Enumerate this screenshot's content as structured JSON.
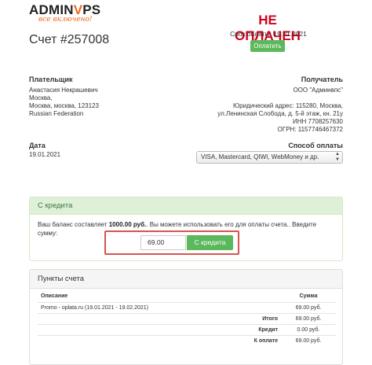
{
  "brand": {
    "name_a": "ADMIN",
    "name_v": "V",
    "name_b": "PS",
    "tagline": "все включено!"
  },
  "invoice": {
    "title": "Счет #257008"
  },
  "status": {
    "text": "НЕ ОПЛАЧЕН",
    "due": "Срок оплаты: 19.01.2021",
    "pay_label": "Оплатить"
  },
  "payer": {
    "label": "Плательщик",
    "lines": [
      "Анастасия Некрашевич",
      "Москва,",
      "Москва, москва, 123123",
      "Russian Federation"
    ]
  },
  "recipient": {
    "label": "Получатель",
    "lines": [
      "ООО \"Админвпс\"",
      "",
      "Юридический адрес: 115280, Москва,",
      "ул.Ленинская Слобода, д. 5-й этаж, кн. 21у",
      "ИНН 7708257630",
      "ОГРН: 1157746467372"
    ]
  },
  "date": {
    "label": "Дата",
    "value": "19.01.2021"
  },
  "payment_method": {
    "label": "Способ оплаты",
    "selected": "VISA, Mastercard, QIWI, WebMoney и др."
  },
  "credit": {
    "title": "С кредита",
    "text_before": "Ваш баланс составляет ",
    "balance": "1000.00 руб.",
    "text_after": ". Вы можете использовать его для оплаты счета.. Введите сумму:",
    "amount": "69.00",
    "button": "С кредита"
  },
  "items": {
    "title": "Пункты счета",
    "col_desc": "Описание",
    "col_sum": "Сумма",
    "rows": [
      {
        "desc": "Promo - oplata.ru (19.01.2021 - 19.02.2021)",
        "sum": "69.00 руб."
      }
    ],
    "totals": [
      {
        "label": "Итого",
        "value": "69.00 руб."
      },
      {
        "label": "Кредит",
        "value": "0.00 руб."
      },
      {
        "label": "К оплате",
        "value": "69.00 руб."
      }
    ]
  },
  "colors": {
    "brand_orange": "#ef6a1f",
    "status_red": "#d0021b",
    "success_green": "#5cb85c",
    "highlight_red": "#d9534f"
  }
}
